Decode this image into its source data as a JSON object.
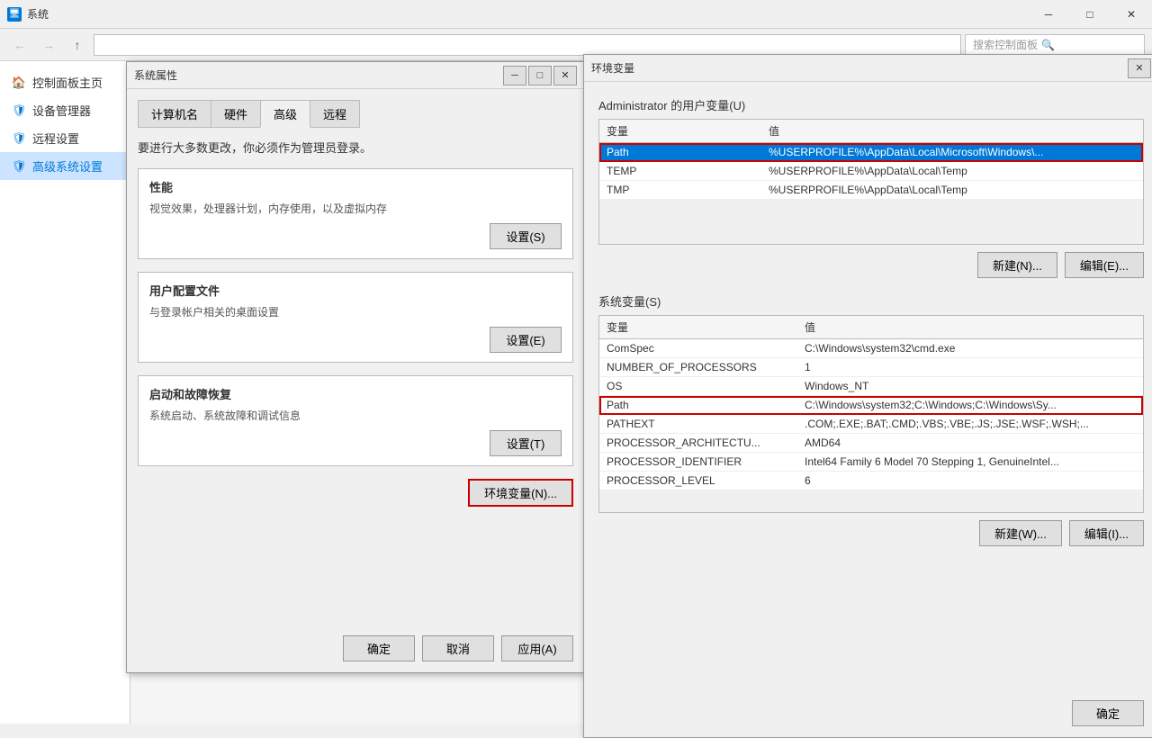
{
  "titlebar": {
    "title": "系统",
    "icon": "🖥",
    "minimize": "─",
    "maximize": "□",
    "close": "✕"
  },
  "navbar": {
    "back": "←",
    "forward": "→",
    "up": "↑",
    "address": "",
    "search_placeholder": "搜索控制面板"
  },
  "sidebar": {
    "items": [
      {
        "label": "控制面板主页",
        "icon": "🏠"
      },
      {
        "label": "设备管理器",
        "icon": "🖥"
      },
      {
        "label": "远程设置",
        "icon": "🖧"
      },
      {
        "label": "高级系统设置",
        "icon": "⚙",
        "active": true
      }
    ]
  },
  "sysprop_dialog": {
    "title": "系统属性",
    "tabs": [
      "计算机名",
      "硬件",
      "高级",
      "远程"
    ],
    "active_tab": "高级",
    "warning_text": "要进行大多数更改，你必须作为管理员登录。",
    "sections": [
      {
        "id": "performance",
        "title": "性能",
        "desc": "视觉效果，处理器计划，内存使用，以及虚拟内存",
        "btn_label": "设置(S)"
      },
      {
        "id": "user_profiles",
        "title": "用户配置文件",
        "desc": "与登录帐户相关的桌面设置",
        "btn_label": "设置(E)"
      },
      {
        "id": "startup",
        "title": "启动和故障恢复",
        "desc": "系统启动、系统故障和调试信息",
        "btn_label": "设置(T)"
      }
    ],
    "env_btn": "环境变量(N)...",
    "footer_btns": {
      "ok": "确定",
      "cancel": "取消",
      "apply": "应用(A)"
    }
  },
  "env_dialog": {
    "title": "环境变量",
    "user_vars_title": "Administrator 的用户变量(U)",
    "user_vars_cols": [
      "变量",
      "值"
    ],
    "user_vars_rows": [
      {
        "var": "Path",
        "val": "%USERPROFILE%\\AppData\\Local\\Microsoft\\Windows\\...",
        "selected": true,
        "highlighted": true
      },
      {
        "var": "TEMP",
        "val": "%USERPROFILE%\\AppData\\Local\\Temp"
      },
      {
        "var": "TMP",
        "val": "%USERPROFILE%\\AppData\\Local\\Temp"
      }
    ],
    "user_btns": {
      "new": "新建(N)...",
      "edit": "编辑(E)..."
    },
    "sys_vars_title": "系统变量(S)",
    "sys_vars_cols": [
      "变量",
      "值"
    ],
    "sys_vars_rows": [
      {
        "var": "ComSpec",
        "val": "C:\\Windows\\system32\\cmd.exe"
      },
      {
        "var": "NUMBER_OF_PROCESSORS",
        "val": "1"
      },
      {
        "var": "OS",
        "val": "Windows_NT"
      },
      {
        "var": "Path",
        "val": "C:\\Windows\\system32;C:\\Windows;C:\\Windows\\Sy...",
        "highlighted": true
      },
      {
        "var": "PATHEXT",
        "val": ".COM;.EXE;.BAT;.CMD;.VBS;.VBE;.JS;.JSE;.WSF;.WSH;..."
      },
      {
        "var": "PROCESSOR_ARCHITECTU...",
        "val": "AMD64"
      },
      {
        "var": "PROCESSOR_IDENTIFIER",
        "val": "Intel64 Family 6 Model 70 Stepping 1, GenuineIntel..."
      },
      {
        "var": "PROCESSOR_LEVEL",
        "val": "6"
      }
    ],
    "sys_btns": {
      "new": "新建(W)...",
      "edit": "编辑(I)..."
    },
    "footer_btn": "确定"
  }
}
